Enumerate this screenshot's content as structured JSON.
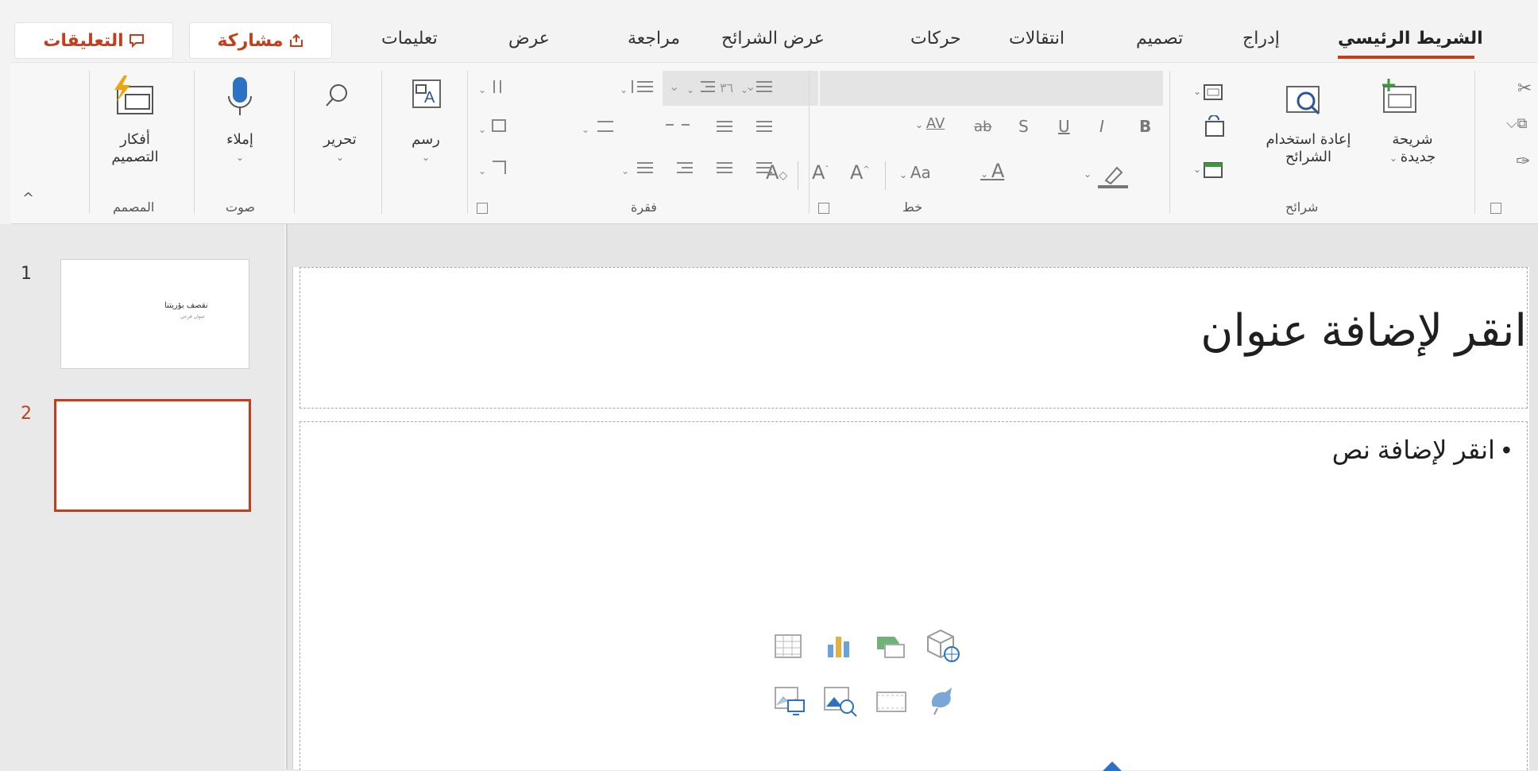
{
  "tabs": {
    "home": "الشريط الرئيسي",
    "insert": "إدراج",
    "design": "تصميم",
    "transitions": "انتقالات",
    "animations": "حركات",
    "slideshow": "عرض الشرائح",
    "review": "مراجعة",
    "view": "عرض",
    "help": "تعليمات"
  },
  "top_buttons": {
    "share": "مشاركة",
    "comments": "التعليقات"
  },
  "ribbon": {
    "slides": {
      "new_slide": [
        "شريحة",
        "جديدة"
      ],
      "reuse_slides": [
        "إعادة استخدام",
        "الشرائح"
      ],
      "group_label": "شرائح"
    },
    "font": {
      "size_value": "٣٦",
      "bold": "B",
      "italic": "I",
      "underline": "U",
      "strike": "S",
      "strike2": "ab",
      "spacing": "AV",
      "change_case": "Aa",
      "font_color": "A",
      "grow": "A",
      "shrink": "A",
      "clear": "A",
      "group_label": "خط"
    },
    "paragraph": {
      "group_label": "فقرة"
    },
    "drawing": {
      "label": "رسم"
    },
    "editing": {
      "label": "تحرير"
    },
    "voice": {
      "dictate": "إملاء",
      "group_label": "صوت"
    },
    "designer": {
      "ideas": [
        "أفكار",
        "التصميم"
      ],
      "group_label": "المصمم"
    }
  },
  "thumbnails": [
    {
      "number": "1",
      "title": "نقصف بؤريتنا",
      "subtitle": "عنوان فرعي"
    },
    {
      "number": "2"
    }
  ],
  "slide": {
    "title_placeholder": "انقر لإضافة عنوان",
    "content_placeholder": "• انقر لإضافة نص"
  },
  "colors": {
    "accent": "#c43e1c",
    "green": "#3b9b3b",
    "blue": "#2b579a"
  }
}
